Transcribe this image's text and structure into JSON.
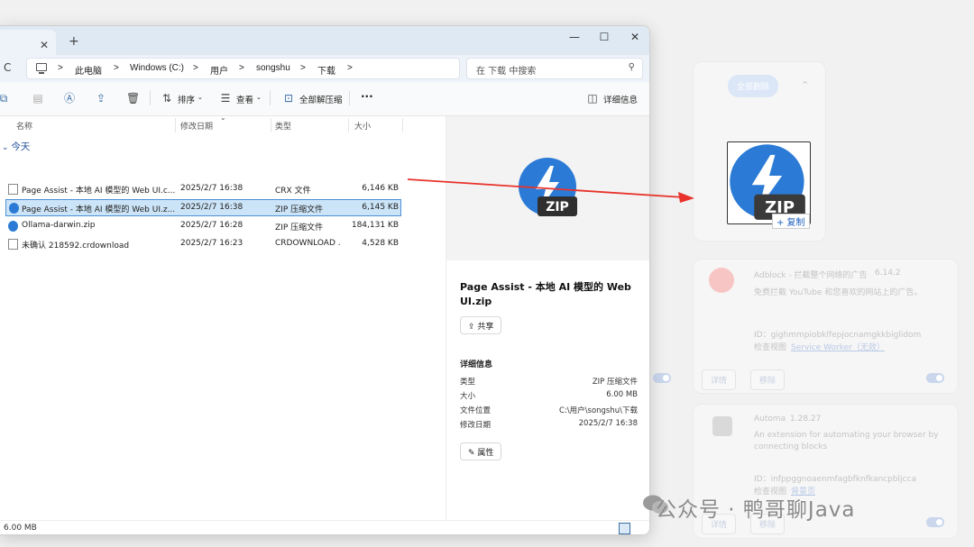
{
  "window": {
    "tab_close": "✕",
    "tab_add": "+",
    "controls": {
      "minimize": "—",
      "maximize": "☐",
      "close": "✕"
    }
  },
  "address": {
    "refresh": "C",
    "sep": ">",
    "crumbs": [
      "此电脑",
      "Windows (C:)",
      "用户",
      "songshu",
      "下载"
    ],
    "search_placeholder": "在 下载 中搜索"
  },
  "toolbar": {
    "sort": "排序",
    "view": "查看",
    "extract_all": "全部解压缩",
    "more": "···",
    "details": "详细信息"
  },
  "columns": {
    "name": "名称",
    "modified": "修改日期",
    "type": "类型",
    "size": "大小"
  },
  "group_label": "今天",
  "files": [
    {
      "name": "Page Assist - 本地 AI 模型的 Web UI.c...",
      "date": "2025/2/7 16:38",
      "type": "CRX 文件",
      "size": "6,146 KB",
      "icon": "doc"
    },
    {
      "name": "Page Assist - 本地 AI 模型的 Web UI.z...",
      "date": "2025/2/7 16:38",
      "type": "ZIP 压缩文件",
      "size": "6,145 KB",
      "icon": "zip"
    },
    {
      "name": "Ollama-darwin.zip",
      "date": "2025/2/7 16:28",
      "type": "ZIP 压缩文件",
      "size": "184,131 KB",
      "icon": "zip"
    },
    {
      "name": "未确认 218592.crdownload",
      "date": "2025/2/7 16:23",
      "type": "CRDOWNLOAD ...",
      "size": "4,528 KB",
      "icon": "doc"
    }
  ],
  "preview": {
    "badge": "ZIP",
    "title": "Page Assist - 本地 AI 模型的 Web UI.zip",
    "share": "共享",
    "section": "详细信息",
    "details": [
      {
        "k": "类型",
        "v": "ZIP 压缩文件"
      },
      {
        "k": "大小",
        "v": "6.00 MB"
      },
      {
        "k": "文件位置",
        "v": "C:\\用户\\songshu\\下载"
      },
      {
        "k": "修改日期",
        "v": "2025/2/7 16:38"
      }
    ],
    "properties": "属性"
  },
  "status": {
    "size": "6.00 MB"
  },
  "drag": {
    "badge": "ZIP",
    "copy": "+ 复制"
  },
  "background": {
    "pill": "全部删除",
    "ext1": {
      "name": "Adblock - 拦截整个网络的广告",
      "version": "6.14.2",
      "desc": "免费拦截 YouTube 和您喜欢的网站上的广告。",
      "id": "ID：gighmmpiobklfepjocnamgkkbiglidom",
      "view_label": "检查视图",
      "view_link": "Service Worker（无效）",
      "btn_detail": "详情",
      "btn_remove": "移除"
    },
    "ext2": {
      "name": "Automa",
      "version": "1.28.27",
      "desc1": "An extension for automating your browser by",
      "desc2": "connecting blocks",
      "id": "ID：infppggnoaenmfagbfknfkancpbljcca",
      "view_label": "检查视图",
      "view_link": "背景页"
    },
    "side_btn": "详情",
    "side_btn2": "移除"
  },
  "watermark": "公众号 · 鸭哥聊Java",
  "colors": {
    "accent": "#2b7bd6",
    "selection": "#cce4f7",
    "arrow": "#e8322b"
  }
}
